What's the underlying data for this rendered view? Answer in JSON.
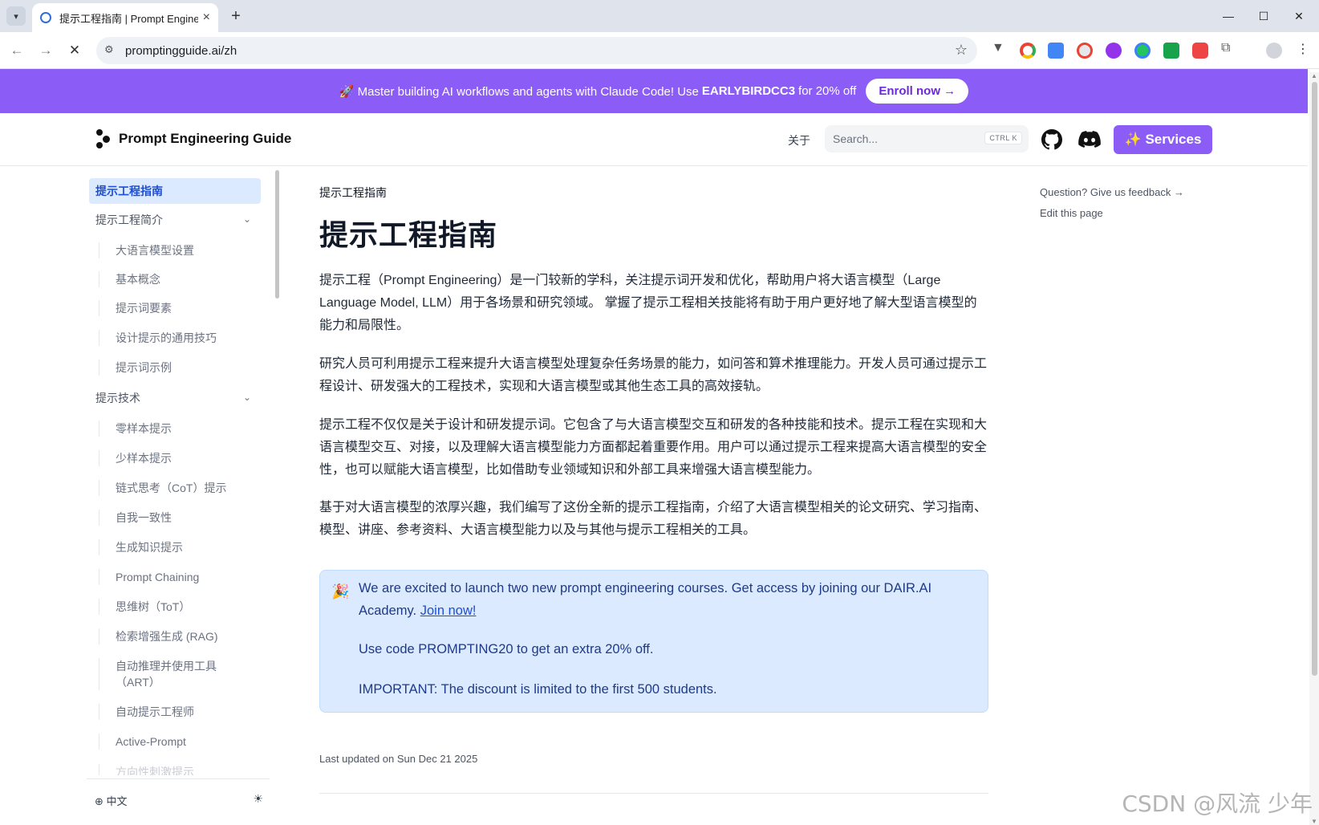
{
  "browser": {
    "tab_title": "提示工程指南 | Prompt Engineering Guide",
    "url": "promptingguide.ai/zh"
  },
  "promo": {
    "text_before": "🚀 Master building AI workflows and agents with Claude Code! Use",
    "code": "EARLYBIRDCC3",
    "text_after": "for 20% off",
    "button": "Enroll now →"
  },
  "header": {
    "logo_text": "Prompt Engineering Guide",
    "about": "关于",
    "search_placeholder": "Search...",
    "search_kbd": "CTRL K",
    "services": "✨ Services"
  },
  "sidebar": {
    "items": [
      {
        "label": "提示工程指南",
        "active": true
      },
      {
        "label": "提示工程简介",
        "expandable": true
      },
      {
        "label": "大语言模型设置",
        "sub": true
      },
      {
        "label": "基本概念",
        "sub": true
      },
      {
        "label": "提示词要素",
        "sub": true
      },
      {
        "label": "设计提示的通用技巧",
        "sub": true
      },
      {
        "label": "提示词示例",
        "sub": true
      },
      {
        "label": "提示技术",
        "expandable": true
      },
      {
        "label": "零样本提示",
        "sub": true
      },
      {
        "label": "少样本提示",
        "sub": true
      },
      {
        "label": "链式思考（CoT）提示",
        "sub": true
      },
      {
        "label": "自我一致性",
        "sub": true
      },
      {
        "label": "生成知识提示",
        "sub": true
      },
      {
        "label": "Prompt Chaining",
        "sub": true
      },
      {
        "label": "思维树（ToT）",
        "sub": true
      },
      {
        "label": "检索增强生成 (RAG)",
        "sub": true
      },
      {
        "label": "自动推理并使用工具（ART）",
        "sub": true
      },
      {
        "label": "自动提示工程师",
        "sub": true
      },
      {
        "label": "Active-Prompt",
        "sub": true
      },
      {
        "label": "方向性刺激提示",
        "sub": true
      }
    ],
    "language": "中文"
  },
  "main": {
    "breadcrumb": "提示工程指南",
    "title": "提示工程指南",
    "paragraphs": [
      "提示工程（Prompt Engineering）是一门较新的学科，关注提示词开发和优化，帮助用户将大语言模型（Large Language Model, LLM）用于各场景和研究领域。 掌握了提示工程相关技能将有助于用户更好地了解大型语言模型的能力和局限性。",
      "研究人员可利用提示工程来提升大语言模型处理复杂任务场景的能力，如问答和算术推理能力。开发人员可通过提示工程设计、研发强大的工程技术，实现和大语言模型或其他生态工具的高效接轨。",
      "提示工程不仅仅是关于设计和研发提示词。它包含了与大语言模型交互和研发的各种技能和技术。提示工程在实现和大语言模型交互、对接，以及理解大语言模型能力方面都起着重要作用。用户可以通过提示工程来提高大语言模型的安全性，也可以赋能大语言模型，比如借助专业领域知识和外部工具来增强大语言模型能力。",
      "基于对大语言模型的浓厚兴趣，我们编写了这份全新的提示工程指南，介绍了大语言模型相关的论文研究、学习指南、模型、讲座、参考资料、大语言模型能力以及与其他与提示工程相关的工具。"
    ],
    "callout": {
      "line1": "We are excited to launch two new prompt engineering courses. Get access by joining our DAIR.AI Academy.",
      "link": "Join now!",
      "line2": "Use code PROMPTING20 to get an extra 20% off.",
      "line3": "IMPORTANT: The discount is limited to the first 500 students."
    },
    "last_updated": "Last updated on Sun Dec 21 2025"
  },
  "toc": {
    "feedback": "Question? Give us feedback →",
    "edit": "Edit this page"
  },
  "watermark": "CSDN @风流 少年",
  "colors": {
    "brand": "#8b5cf6",
    "active_bg": "#dbeafe",
    "callout_bg": "#dbeafe"
  }
}
